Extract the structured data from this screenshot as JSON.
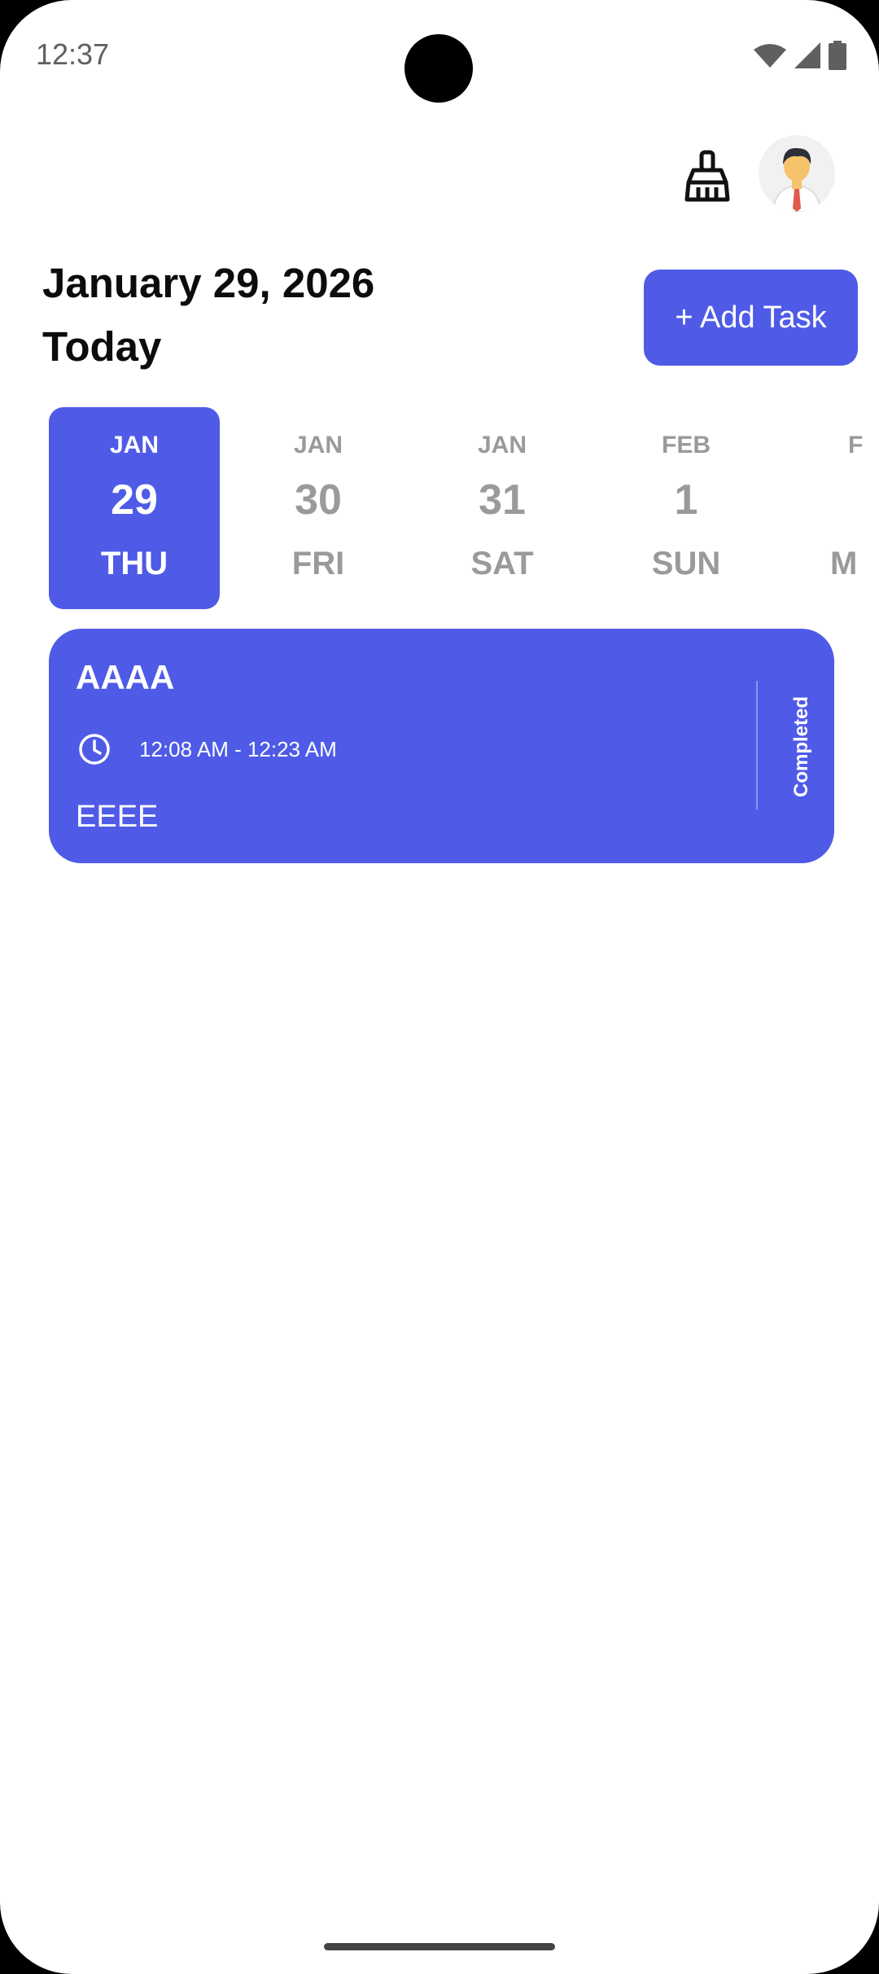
{
  "status": {
    "time": "12:37",
    "icons": [
      "wifi-icon",
      "signal-icon",
      "battery-icon"
    ]
  },
  "header": {
    "date": "January 29, 2026",
    "subtitle": "Today",
    "add_label": "+ Add Task",
    "icons": [
      "moon-icon",
      "broom-icon",
      "avatar"
    ]
  },
  "days": [
    {
      "month": "JAN",
      "day": "29",
      "weekday": "THU",
      "selected": true
    },
    {
      "month": "JAN",
      "day": "30",
      "weekday": "FRI"
    },
    {
      "month": "JAN",
      "day": "31",
      "weekday": "SAT"
    },
    {
      "month": "FEB",
      "day": "1",
      "weekday": "SUN"
    },
    {
      "month": "F",
      "day": "",
      "weekday": "M"
    }
  ],
  "task": {
    "title": "AAAA",
    "time": "12:08 AM - 12:23 AM",
    "note": "EEEE",
    "status": "Completed"
  },
  "colors": {
    "accent": "#4f5be7",
    "muted": "#9a9a9a"
  }
}
